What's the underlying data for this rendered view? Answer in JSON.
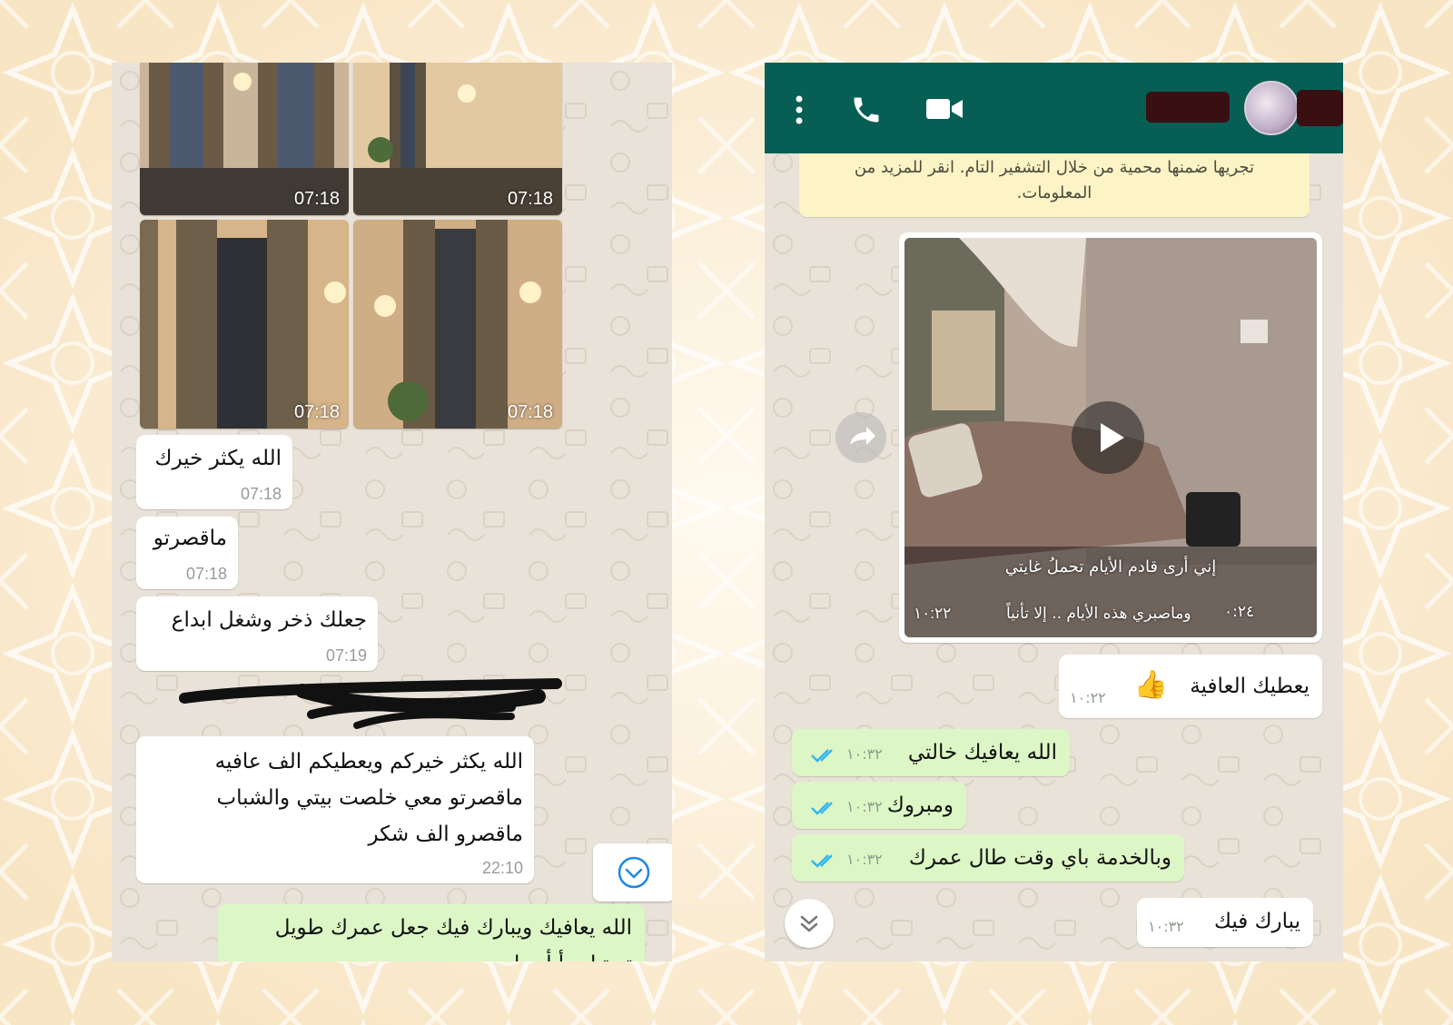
{
  "left_chat": {
    "image_grid": [
      {
        "time": "07:18"
      },
      {
        "time": "07:18"
      },
      {
        "time": "07:18"
      },
      {
        "time": "07:18"
      }
    ],
    "messages": [
      {
        "text": "الله يكثر خيرك",
        "time": "07:18"
      },
      {
        "text": "ماقصرتو",
        "time": "07:18"
      },
      {
        "text": "جعلك ذخر وشغل ابداع",
        "time": "07:19"
      },
      {
        "text_lines": [
          "الله يكثر خيركم ويعطيكم الف عافيه",
          "ماقصرتو معي خلصت بيتي والشباب",
          "ماقصرو الف شكر"
        ],
        "time": "22:10"
      }
    ],
    "outgoing_partial": {
      "line1": "الله يعافيك ويبارك فيك جعل عمرك طويل",
      "line2": "تو تباب أبأب ا"
    },
    "scroll_icon": "chevron-down-circle-icon"
  },
  "right_chat": {
    "header": {
      "icons": [
        "more-vert-icon",
        "phone-icon",
        "video-call-icon"
      ],
      "contact_name": ""
    },
    "encryption_note": {
      "line1": "تجريها ضمنها محمية من خلال التشفير التام. انقر للمزيد من",
      "line2": "المعلومات."
    },
    "video": {
      "caption1": "إني أرى قادم الأيام تحملُ غايتي",
      "caption2": "وماصبري هذه الأيام .. إلا تأنياً",
      "duration": "٠:٢٤",
      "time": "١٠:٢٢"
    },
    "messages": [
      {
        "dir": "in",
        "text": "يعطيك العافية",
        "time": "١٠:٢٢",
        "emoji": "👍"
      },
      {
        "dir": "out",
        "text": "الله يعافيك خالتي",
        "time": "١٠:٣٢"
      },
      {
        "dir": "out",
        "text": "ومبروك",
        "time": "١٠:٣٢"
      },
      {
        "dir": "out",
        "text": "وبالخدمة باي وقت طال عمرك",
        "time": "١٠:٣٢"
      },
      {
        "dir": "in",
        "text": "يبارك فيك",
        "time": "١٠:٣٢"
      }
    ]
  },
  "colors": {
    "header_green": "#075e54",
    "outgoing_bubble": "#dcf7c5",
    "incoming_bubble": "#ffffff",
    "read_ticks": "#34b7f1",
    "page_background": "#fbf1dd"
  }
}
